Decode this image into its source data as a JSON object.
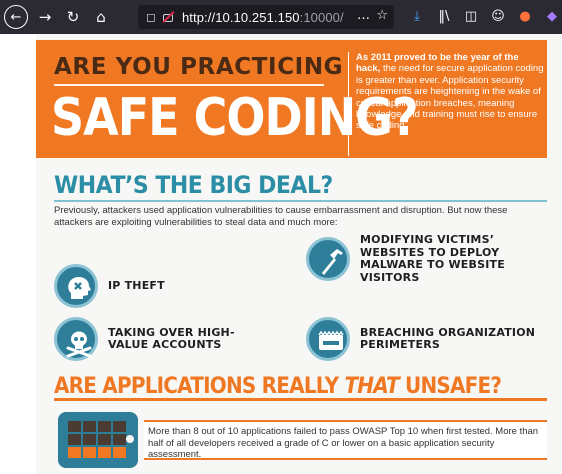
{
  "browser": {
    "url_host": "http://10.10.251.150",
    "url_port": ":10000/",
    "more_label": "…",
    "icons": [
      "back-icon",
      "forward-icon",
      "reload-icon",
      "home-icon",
      "shield-icon",
      "insecure-lock-icon",
      "star-icon",
      "download-icon",
      "library-icon",
      "sidebar-icon",
      "account-icon",
      "extension-icon"
    ]
  },
  "header": {
    "line1": "ARE YOU PRACTICING",
    "line2": "SAFE CODING?",
    "intro_bold": "As 2011 proved to be the year of the hack,",
    "intro_rest": "the need for secure application coding is greater than ever. Application security requirements are heightening in the wake of critical application breaches, meaning knowledge and training must rise to ensure safe coding."
  },
  "section1": {
    "title": "WHAT’S THE BIG DEAL?",
    "description": "Previously, attackers used application vulnerabilities to cause embarrassment and disruption. But now these attackers are exploiting vulnerabilities to steal data and much more:",
    "features": [
      {
        "label": "IP THEFT",
        "icon": "head-icon"
      },
      {
        "label": "MODIFYING VICTIMS’ WEBSITES TO DEPLOY MALWARE TO WEBSITE VISITORS",
        "icon": "hammer-icon"
      },
      {
        "label": "TAKING OVER HIGH-VALUE ACCOUNTS",
        "icon": "skull-crossbones-icon"
      },
      {
        "label": "BREACHING ORGANIZATION PERIMETERS",
        "icon": "wall-icon"
      }
    ]
  },
  "section2": {
    "title_pre": "ARE APPLICATIONS REALLY ",
    "title_em": "THAT",
    "title_post": " UNSAFE?",
    "text": "More than 8 out of 10 applications failed to pass OWASP Top 10 when first tested. More than half of all developers received a grade of C or lower on a basic application security assessment.",
    "icon": "tablet-icon"
  },
  "colors": {
    "orange": "#f07823",
    "teal": "#2e7e9a",
    "dark_brown": "#4a2a14",
    "chrome": "#2b2a33"
  }
}
